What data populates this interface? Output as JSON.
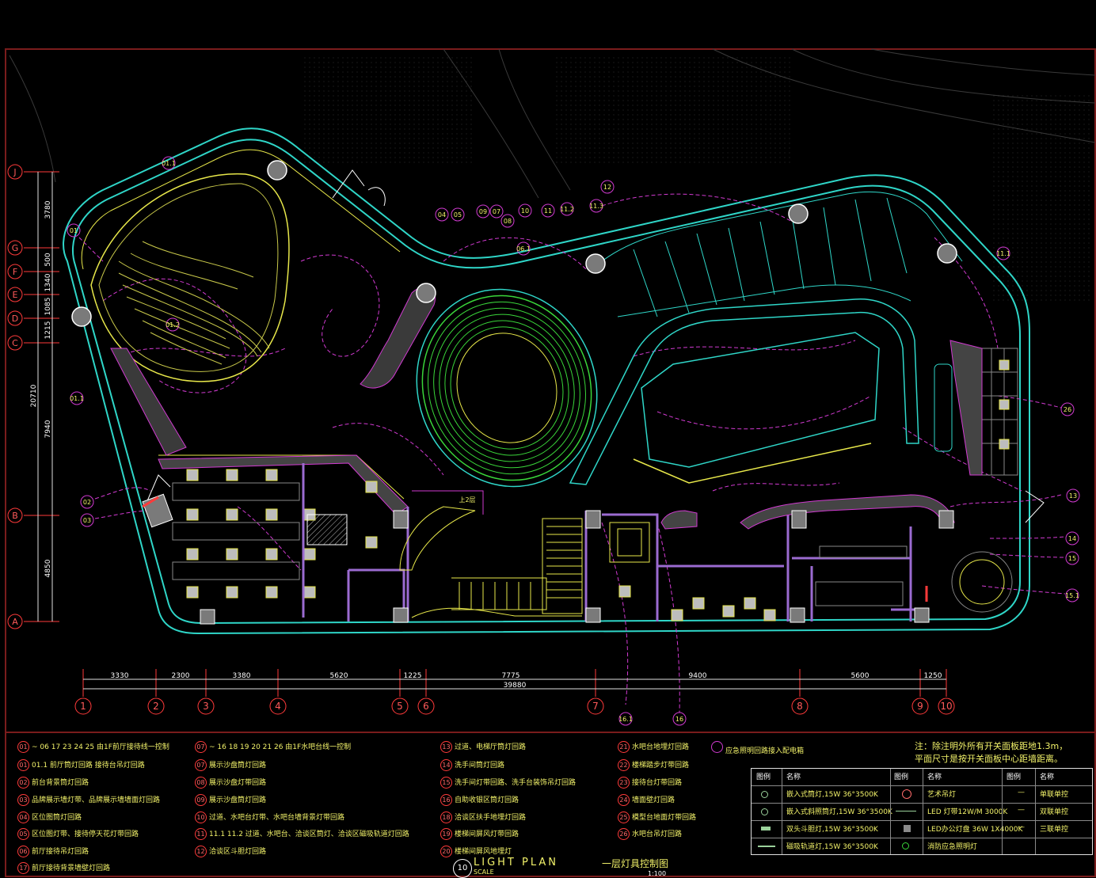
{
  "drawing": {
    "title_en": "LIGHT   PLAN",
    "title_cn": "一层灯具控制图",
    "scale_label": "SCALE",
    "scale_value": "1:100",
    "drawing_number": "10"
  },
  "grid_columns": [
    {
      "label": "1"
    },
    {
      "label": "2"
    },
    {
      "label": "3"
    },
    {
      "label": "4"
    },
    {
      "label": "5"
    },
    {
      "label": "6"
    },
    {
      "label": "7"
    },
    {
      "label": "8"
    },
    {
      "label": "9"
    },
    {
      "label": "10"
    }
  ],
  "column_dimensions": [
    "3330",
    "2300",
    "3380",
    "5620",
    "1225",
    "7775",
    "9400",
    "5600",
    "1250"
  ],
  "total_width": "39880",
  "grid_rows": [
    {
      "label": "J"
    },
    {
      "label": "G"
    },
    {
      "label": "F"
    },
    {
      "label": "E"
    },
    {
      "label": "D"
    },
    {
      "label": "C"
    },
    {
      "label": "B"
    },
    {
      "label": "A"
    }
  ],
  "row_dimensions": [
    "3780",
    "500",
    "1340",
    "1085",
    "1215",
    "7940",
    "4850"
  ],
  "total_height": "20710",
  "circuit_tags": {
    "t01": "01",
    "t011": "01.1",
    "t012": "01.2",
    "t02": "02",
    "t03": "03",
    "t04": "04",
    "t05": "05",
    "t06": "06",
    "t07": "07",
    "t08": "08",
    "t09": "09",
    "t10": "10",
    "t11": "11",
    "t112": "11.2",
    "t113": "11.3",
    "t111": "11.1",
    "t12": "12",
    "t13": "13",
    "t14": "14",
    "t15": "15",
    "t151": "15.1",
    "t16": "16",
    "t161": "16.1",
    "t26": "26",
    "t061": "06.1",
    "stair": "上2层"
  },
  "legend_left": [
    {
      "num": "01",
      "text": "~ 06 17 23 24 25 由1F前厅接待线一控制"
    },
    {
      "num": "01",
      "text": "01.1 前厅筒灯回路 接待台吊灯回路"
    },
    {
      "num": "02",
      "text": "前台背景筒灯回路"
    },
    {
      "num": "03",
      "text": "品牌展示墙灯带、品牌展示墙墙面灯回路"
    },
    {
      "num": "04",
      "text": "区位图筒灯回路"
    },
    {
      "num": "05",
      "text": "区位图灯带、接待停天花灯带回路"
    },
    {
      "num": "06",
      "text": "前厅接待吊灯回路"
    },
    {
      "num": "17",
      "text": "前厅接待背景墙壁灯回路"
    }
  ],
  "legend_mid": [
    {
      "num": "07",
      "text": "~ 16 18 19 20 21 26 由1F水吧台线一控制"
    },
    {
      "num": "07",
      "text": "展示沙盘筒灯回路"
    },
    {
      "num": "08",
      "text": "展示沙盘灯带回路"
    },
    {
      "num": "09",
      "text": "展示沙盘筒灯回路"
    },
    {
      "num": "10",
      "text": "过道、水吧台灯带、水吧台墙背景灯带回路"
    },
    {
      "num": "11",
      "text": "11.1 11.2 过道、水吧台、洽谈区筒灯、洽谈区磁吸轨道灯回路"
    },
    {
      "num": "12",
      "text": "洽谈区斗胆灯回路"
    }
  ],
  "legend_right1": [
    {
      "num": "13",
      "text": "过道、电梯厅筒灯回路"
    },
    {
      "num": "14",
      "text": "洗手间筒灯回路"
    },
    {
      "num": "15",
      "text": "洗手间灯带回路、洗手台装饰吊灯回路"
    },
    {
      "num": "16",
      "text": "自助收银区筒灯回路"
    },
    {
      "num": "18",
      "text": "洽谈区扶手地埋灯回路"
    },
    {
      "num": "19",
      "text": "楼梯间屏风灯带回路"
    },
    {
      "num": "20",
      "text": "楼梯间屏风地埋灯"
    }
  ],
  "legend_right2": [
    {
      "num": "21",
      "text": "水吧台地埋灯回路"
    },
    {
      "num": "22",
      "text": "楼梯踏步灯带回路"
    },
    {
      "num": "23",
      "text": "接待台灯带回路"
    },
    {
      "num": "24",
      "text": "墙面壁灯回路"
    },
    {
      "num": "25",
      "text": "模型台地面灯带回路"
    },
    {
      "num": "26",
      "text": "水吧台吊灯回路"
    }
  ],
  "emergency_note": "应急照明回路接入配电箱",
  "general_note": {
    "line1": "注：除注明外所有开关面板距地1.3m，",
    "line2": "平面尺寸是按开关面板中心距墙距离。"
  },
  "fixture_table": {
    "headers": [
      "图例",
      "名称",
      "图例",
      "名称",
      "图例",
      "名称"
    ],
    "rows": [
      {
        "c1": "嵌入式筒灯,15W 36°3500K",
        "c2": "艺术吊灯",
        "c3": "—",
        "c4": "单联单控"
      },
      {
        "c1": "嵌入式斜照筒灯,15W 36°3500K",
        "c2": "LED 灯带12W/M 3000K",
        "c3": "—",
        "c4": "双联单控"
      },
      {
        "c1": "双头斗胆灯,15W 36°3500K",
        "c2": "LED办公灯盘 36W 1X4000K",
        "c3": "—",
        "c4": "三联单控"
      },
      {
        "c1": "磁吸轨道灯,15W 36°3500K",
        "c2": "消防应急照明灯",
        "c3": "",
        "c4": ""
      }
    ]
  },
  "colors": {
    "background": "#000000",
    "exterior_wall": "#2fd6c8",
    "magenta_circuit": "#d13ad1",
    "yellow_fixture": "#e8e84a",
    "green_seating": "#3ad63a",
    "grid_red": "#ff3a3a",
    "text_yellow": "#f2f26a"
  }
}
